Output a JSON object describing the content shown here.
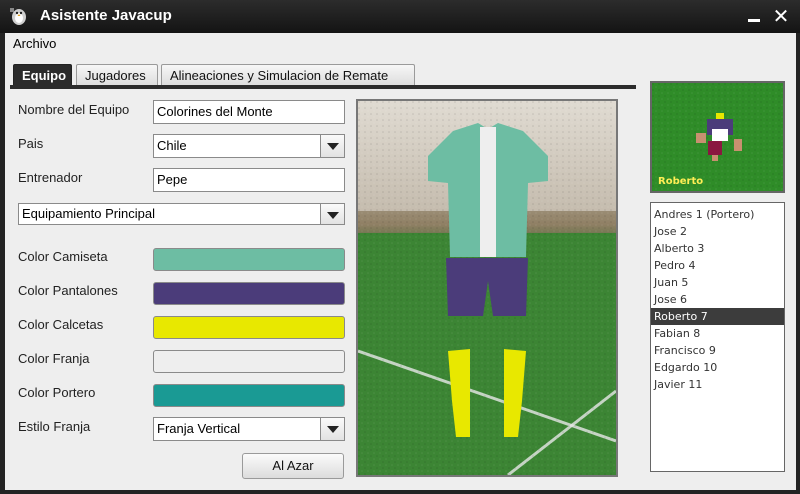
{
  "window": {
    "title": "Asistente Javacup",
    "minimize_glyph": "—",
    "close_glyph": "✕"
  },
  "menu": {
    "archivo": "Archivo"
  },
  "tabs": [
    {
      "label": "Equipo"
    },
    {
      "label": "Jugadores"
    },
    {
      "label": "Alineaciones y Simulacion de Remate"
    }
  ],
  "form": {
    "team_name_label": "Nombre del Equipo",
    "team_name_value": "Colorines del Monte",
    "country_label": "Pais",
    "country_value": "Chile",
    "coach_label": "Entrenador",
    "coach_value": "Pepe",
    "equipment_value": "Equipamiento Principal",
    "shirt_color_label": "Color Camiseta",
    "pants_color_label": "Color Pantalones",
    "socks_color_label": "Color Calcetas",
    "stripe_color_label": "Color Franja",
    "goalkeeper_color_label": "Color Portero",
    "stripe_style_label": "Estilo Franja",
    "stripe_style_value": "Franja Vertical",
    "random_button": "Al Azar"
  },
  "colors": {
    "shirt": "#6dbda3",
    "pants": "#4b3c7a",
    "socks": "#e8e800",
    "stripe": "#eeeeee",
    "goalkeeper": "#1a9a94"
  },
  "player_preview": {
    "name": "Roberto"
  },
  "roster": [
    "Andres 1 (Portero)",
    "Jose 2",
    "Alberto 3",
    "Pedro 4",
    "Juan 5",
    "Jose 6",
    "Roberto 7",
    "Fabian 8",
    "Francisco 9",
    "Edgardo 10",
    "Javier 11"
  ],
  "roster_selected": "Roberto 7",
  "icons": {
    "app": "penguin-icon",
    "dropdown": "chevron-down-icon"
  }
}
